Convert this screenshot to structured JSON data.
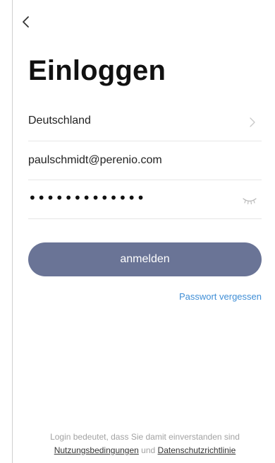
{
  "header": {
    "back_icon": "chevron-left-icon",
    "title": "Einloggen"
  },
  "form": {
    "country": {
      "value": "Deutschland",
      "icon": "chevron-right-icon"
    },
    "email": {
      "value": "paulschmidt@perenio.com"
    },
    "password": {
      "value": "•••••••••••••",
      "icon": "eye-closed-icon"
    },
    "submit_label": "anmelden",
    "forgot_label": "Passwort vergessen"
  },
  "footer": {
    "text": "Login bedeutet, dass Sie damit einverstanden sind",
    "terms_label": "Nutzungsbedingungen",
    "and_label": "und",
    "privacy_label": "Datenschutzrichtlinie"
  },
  "colors": {
    "button": "#6a7496",
    "link": "#3f8ed6",
    "divider": "#e6e6e6",
    "muted_text": "#a2a2a2"
  }
}
